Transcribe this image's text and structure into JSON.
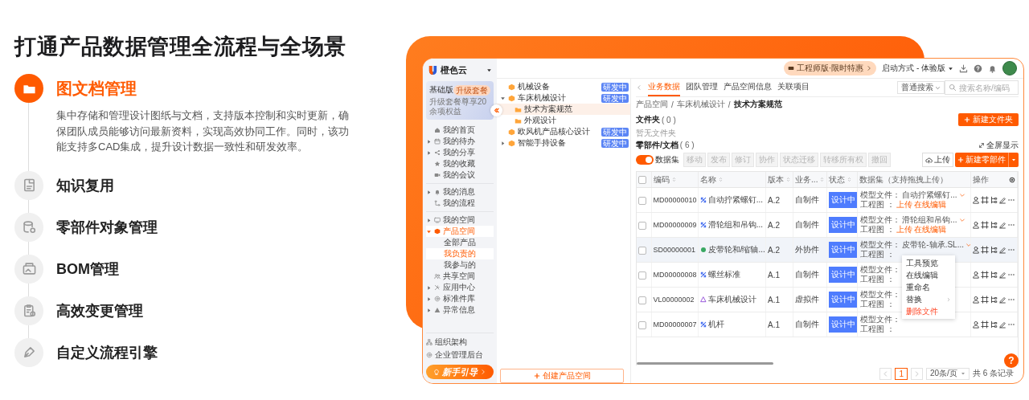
{
  "headline": "打通产品数据管理全流程与全场景",
  "features": [
    {
      "title": "图文档管理",
      "selected": true,
      "description": "集中存储和管理设计图纸与文档，支持版本控制和实时更新，确保团队成员能够访问最新资料，实现高效协同工作。同时，该功能支持多CAD集成，提升设计数据一致性和研发效率。"
    },
    {
      "title": "知识复用",
      "selected": false
    },
    {
      "title": "零部件对象管理",
      "selected": false
    },
    {
      "title": "BOM管理",
      "selected": false
    },
    {
      "title": "高效变更管理",
      "selected": false
    },
    {
      "title": "自定义流程引擎",
      "selected": false
    }
  ],
  "app": {
    "sidebar": {
      "brand": "橙色云",
      "plan": {
        "name": "基础版",
        "upgrade": "升级套餐",
        "note": "升级套餐尊享20余项权益"
      },
      "groups": [
        {
          "items": [
            {
              "label": "我的首页",
              "selected": false
            },
            {
              "label": "我的待办",
              "expanded": false,
              "selected": false
            },
            {
              "label": "我的分享",
              "expanded": false,
              "selected": false
            },
            {
              "label": "我的收藏",
              "selected": false
            },
            {
              "label": "我的会议",
              "selected": false
            }
          ]
        },
        {
          "items": [
            {
              "label": "我的消息",
              "expanded": false,
              "selected": false
            },
            {
              "label": "我的流程",
              "selected": false
            }
          ]
        },
        {
          "items": [
            {
              "label": "我的空间",
              "expanded": false,
              "selected": false
            },
            {
              "label": "产品空间",
              "expanded": true,
              "selected": true,
              "children": [
                {
                  "label": "全部产品",
                  "selected": false
                },
                {
                  "label": "我负责的",
                  "selected": true
                },
                {
                  "label": "我参与的",
                  "selected": false
                }
              ]
            },
            {
              "label": "共享空间",
              "selected": false
            },
            {
              "label": "应用中心",
              "expanded": false,
              "selected": false
            },
            {
              "label": "标准件库",
              "expanded": false,
              "selected": false
            },
            {
              "label": "异常信息",
              "expanded": false,
              "selected": false
            }
          ]
        }
      ],
      "footer_links": [
        {
          "label": "组织架构"
        },
        {
          "label": "企业管理后台"
        }
      ],
      "guide_button": "新手引导"
    },
    "topbar": {
      "promo": "工程师版·限时特惠",
      "launch_mode": "启动方式 - 体验版"
    },
    "tree": {
      "items": [
        {
          "label": "机械设备",
          "badge": "研发中",
          "selected": false
        },
        {
          "label": "车床机械设计",
          "badge": "研发中",
          "expanded": true,
          "selected": false,
          "children": [
            {
              "label": "技术方案规范",
              "selected": true
            },
            {
              "label": "外观设计",
              "selected": false
            }
          ]
        },
        {
          "label": "欧风机产品核心设计",
          "badge": "研发中",
          "selected": false
        },
        {
          "label": "智能手持设备",
          "badge": "研发中",
          "expanded": false,
          "selected": false
        }
      ],
      "create_button": "创建产品空间"
    },
    "main": {
      "tabs": [
        {
          "label": "业务数据",
          "selected": true
        },
        {
          "label": "团队管理",
          "selected": false
        },
        {
          "label": "产品空间信息",
          "selected": false
        },
        {
          "label": "关联项目",
          "selected": false
        }
      ],
      "search_mode": "普通搜索",
      "search": {
        "placeholder": "搜索名称/编码"
      },
      "breadcrumb": [
        {
          "label": "产品空间",
          "kind": "link"
        },
        {
          "label": "/",
          "kind": "separator"
        },
        {
          "label": "车床机械设计",
          "kind": "link"
        },
        {
          "label": "/",
          "kind": "separator"
        },
        {
          "label": "技术方案规范",
          "kind": "current"
        }
      ],
      "folders": {
        "title": "文件夹",
        "count": "( 0 )",
        "new_button": "新建文件夹",
        "empty": "暂无文件夹"
      },
      "parts": {
        "title": "零部件/文档",
        "count": "( 6 )",
        "fullscreen": "全屏显示",
        "dataset_toggle": {
          "label": "数据集",
          "on": true
        },
        "actions": [
          {
            "label": "移动",
            "disabled": true
          },
          {
            "label": "发布",
            "disabled": true
          },
          {
            "label": "修订",
            "disabled": true
          },
          {
            "label": "协作",
            "disabled": true
          },
          {
            "label": "状态迁移",
            "disabled": true
          },
          {
            "label": "转移所有权",
            "disabled": true
          },
          {
            "label": "撤回",
            "disabled": true
          }
        ],
        "upload": "上传",
        "new_button": "新建零部件"
      },
      "table": {
        "header_checked": false,
        "columns": [
          {
            "label": "编码",
            "sortable": true
          },
          {
            "label": "名称",
            "sortable": true
          },
          {
            "label": "版本",
            "sortable": true
          },
          {
            "label": "业务...",
            "sortable": true
          },
          {
            "label": "状态",
            "sortable": true
          },
          {
            "label": "数据集（支持拖拽上传）",
            "sortable": false
          },
          {
            "label": "操作",
            "sortable": false
          }
        ],
        "rows": [
          {
            "code": "MD00000010",
            "name": "自动拧紧螺钉...",
            "kind": "part",
            "version": "A.2",
            "type": "自制件",
            "status": "设计中",
            "checked": false,
            "selected": false,
            "model_label": "模型文件：",
            "model_file": "自动拧紧螺钉...",
            "drawing_label": "工程图 ：",
            "links": [
              "上传",
              "在线编辑"
            ]
          },
          {
            "code": "MD00000009",
            "name": "滑轮组和吊钩...",
            "kind": "part",
            "version": "A.2",
            "type": "自制件",
            "status": "设计中",
            "checked": false,
            "selected": false,
            "model_label": "模型文件：",
            "model_file": "滑轮组和吊钩...",
            "drawing_label": "工程图 ：",
            "links": [
              "上传",
              "在线编辑"
            ]
          },
          {
            "code": "SD00000001",
            "name": "皮带轮和/缩轴...",
            "kind": "outsourced",
            "version": "A.2",
            "type": "外协件",
            "status": "设计中",
            "checked": false,
            "selected": true,
            "model_label": "模型文件：",
            "model_file": "皮带轮-轴承.SL...",
            "drawing_label": "工程图 ："
          },
          {
            "code": "MD00000008",
            "name": "螺丝标准",
            "kind": "part",
            "version": "A.1",
            "type": "自制件",
            "status": "设计中",
            "checked": false,
            "selected": false,
            "model_label": "模型文件：",
            "drawing_label": "工程图 ："
          },
          {
            "code": "VL00000002",
            "name": "车床机械设计",
            "kind": "virtual",
            "version": "A.1",
            "type": "虚拟件",
            "status": "设计中",
            "checked": false,
            "selected": false,
            "model_label": "模型文件：",
            "drawing_label": "工程图 ："
          },
          {
            "code": "MD00000007",
            "name": "机杆",
            "kind": "part",
            "version": "A.1",
            "type": "自制件",
            "status": "设计中",
            "checked": false,
            "selected": false,
            "model_label": "模型文件：",
            "drawing_label": "工程图 ："
          }
        ]
      },
      "context_menu": [
        {
          "label": "工具预览",
          "kind": "item"
        },
        {
          "label": "在线编辑",
          "kind": "item"
        },
        {
          "label": "重命名",
          "kind": "item"
        },
        {
          "label": "替换",
          "kind": "submenu"
        },
        {
          "label": "删除文件",
          "kind": "danger"
        }
      ],
      "pagination": {
        "page": "1",
        "page_size": "20条/页",
        "total": "共 6 条记录"
      },
      "help": "?"
    }
  }
}
